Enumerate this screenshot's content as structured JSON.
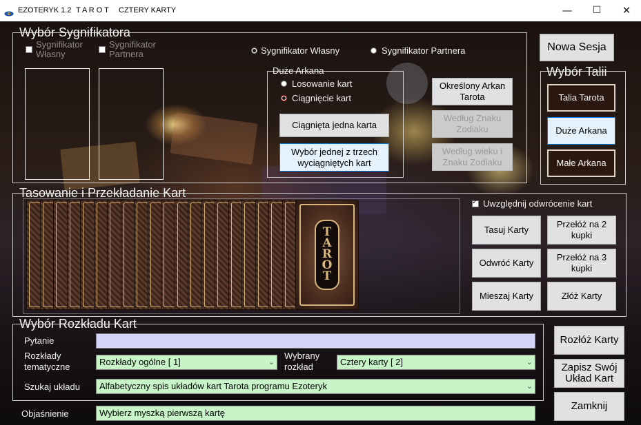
{
  "window": {
    "icon": "eye-icon",
    "app_title": "EZOTERYK 1.2",
    "title_part2": "T A R O T",
    "title_part3": "CZTERY KARTY",
    "minimize": "—",
    "maximize": "☐",
    "close": "✕"
  },
  "significator": {
    "legend": "Wybór Sygnifikatora",
    "own_checkbox": "Sygnifikator Własny",
    "partner_checkbox": "Sygnifikator Partnera",
    "radio_own": "Sygnifikator Własny",
    "radio_partner": "Sygnifikator Partnera",
    "radio_selected": "own"
  },
  "major_arcana_group": {
    "legend": "Duże Arkana",
    "radio_random": "Losowanie kart",
    "radio_draw": "Ciągnięcie kart",
    "radio_selected": "draw",
    "btn_one_card": "Ciągnięta jedna karta",
    "btn_choose_three": "Wybór jednej z trzech wyciągniętych kart"
  },
  "arcana_buttons": {
    "specific": "Określony Arkan Tarota",
    "by_zodiac": "Według Znaku Zodiaku",
    "by_age_zodiac": "Według wieku i Znaku Zodiaku"
  },
  "session": {
    "new_session": "Nowa Sesja"
  },
  "deck_choice": {
    "legend": "Wybór Talii",
    "tarot_deck": "Talia Tarota",
    "major_arcana": "Duże Arkana",
    "minor_arcana": "Małe Arkana"
  },
  "shuffle": {
    "legend": "Tasowanie i Przekładanie Kart",
    "deck_back_word": "TAROT",
    "card_count": 20,
    "reversal_checkbox": "Uwzględnij odwrócenie kart",
    "reversal_checked": true,
    "btn_shuffle": "Tasuj Karty",
    "btn_cut2": "Przełóż na 2 kupki",
    "btn_flip": "Odwróć Karty",
    "btn_cut3": "Przełóż na 3 kupki",
    "btn_mix": "Mieszaj Karty",
    "btn_fold": "Złóż Karty"
  },
  "spread": {
    "legend": "Wybór Rozkładu Kart",
    "question_label": "Pytanie",
    "question_value": "",
    "thematic_label_1": "Rozkłady",
    "thematic_label_2": "tematyczne",
    "thematic_value": "Rozkłady ogólne [ 1]",
    "chosen_label_1": "Wybrany",
    "chosen_label_2": "rozkład",
    "chosen_value": "Cztery karty [ 2]",
    "search_label": "Szukaj układu",
    "search_value": "Alfabetyczny spis układów kart Tarota programu Ezoteryk",
    "explanation_label": "Objaśnienie",
    "explanation_value": "Wybierz myszką pierwszą kartę"
  },
  "actions": {
    "lay_out": "Rozłóż Karty",
    "save_layout": "Zapisz Swój Układ Kart",
    "close": "Zamknij"
  },
  "colors": {
    "input_lilac": "#d4d4fa",
    "input_green": "#c8f5c8",
    "dark_button": "#2a1710",
    "accent_blue": "#0078d7"
  }
}
